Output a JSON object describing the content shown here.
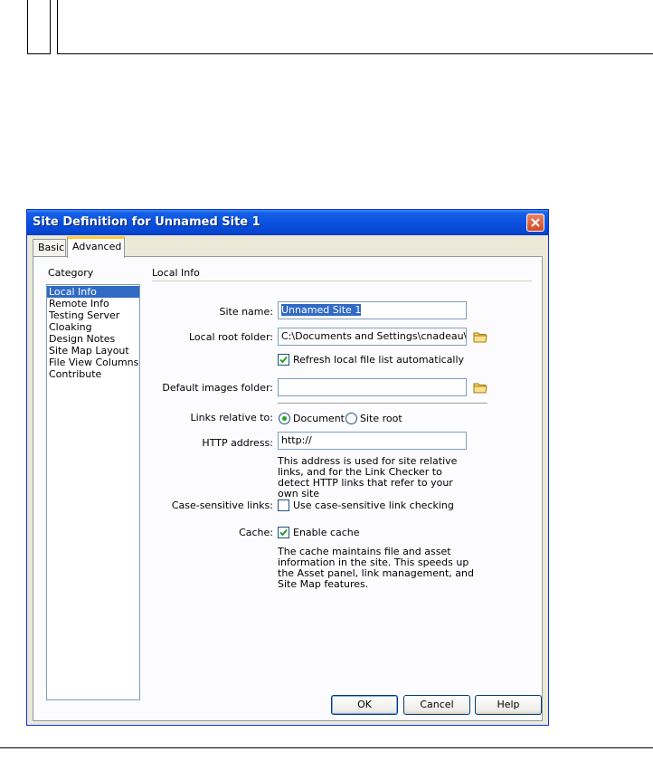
{
  "dialog": {
    "title": "Site Definition for Unnamed Site 1",
    "tabs": [
      {
        "label": "Basic",
        "active": false
      },
      {
        "label": "Advanced",
        "active": true
      }
    ],
    "category": {
      "label": "Category",
      "items": [
        "Local Info",
        "Remote Info",
        "Testing Server",
        "Cloaking",
        "Design Notes",
        "Site Map Layout",
        "File View Columns",
        "Contribute"
      ],
      "selected": "Local Info"
    },
    "local_info": {
      "section_title": "Local Info",
      "site_name_label": "Site name:",
      "site_name_value": "Unnamed Site 1",
      "local_root_label": "Local root folder:",
      "local_root_value": "C:\\Documents and Settings\\cnadeau\\My I",
      "refresh_label": "Refresh local file list automatically",
      "refresh_checked": true,
      "default_images_label": "Default images folder:",
      "default_images_value": "",
      "links_relative_label": "Links relative to:",
      "links_options": [
        "Document",
        "Site root"
      ],
      "links_selected": "Document",
      "http_label": "HTTP address:",
      "http_value": "http://",
      "http_desc": "This address is used for site relative links, and for the Link Checker to detect HTTP links that refer to your own site",
      "case_label": "Case-sensitive links:",
      "case_option": "Use case-sensitive link checking",
      "case_checked": false,
      "cache_label": "Cache:",
      "cache_option": "Enable cache",
      "cache_checked": true,
      "cache_desc": "The cache maintains file and asset information in the site.  This speeds up the Asset panel, link management, and Site Map features."
    },
    "buttons": {
      "ok": "OK",
      "cancel": "Cancel",
      "help": "Help"
    }
  },
  "colors": {
    "titlebar": "#0a4fdc",
    "selection": "#316ac5",
    "dialog_bg": "#ece9d8",
    "close_button": "#d44a24"
  },
  "icons": [
    "close-icon",
    "folder-icon",
    "checkmark-icon",
    "radio-dot-icon"
  ]
}
